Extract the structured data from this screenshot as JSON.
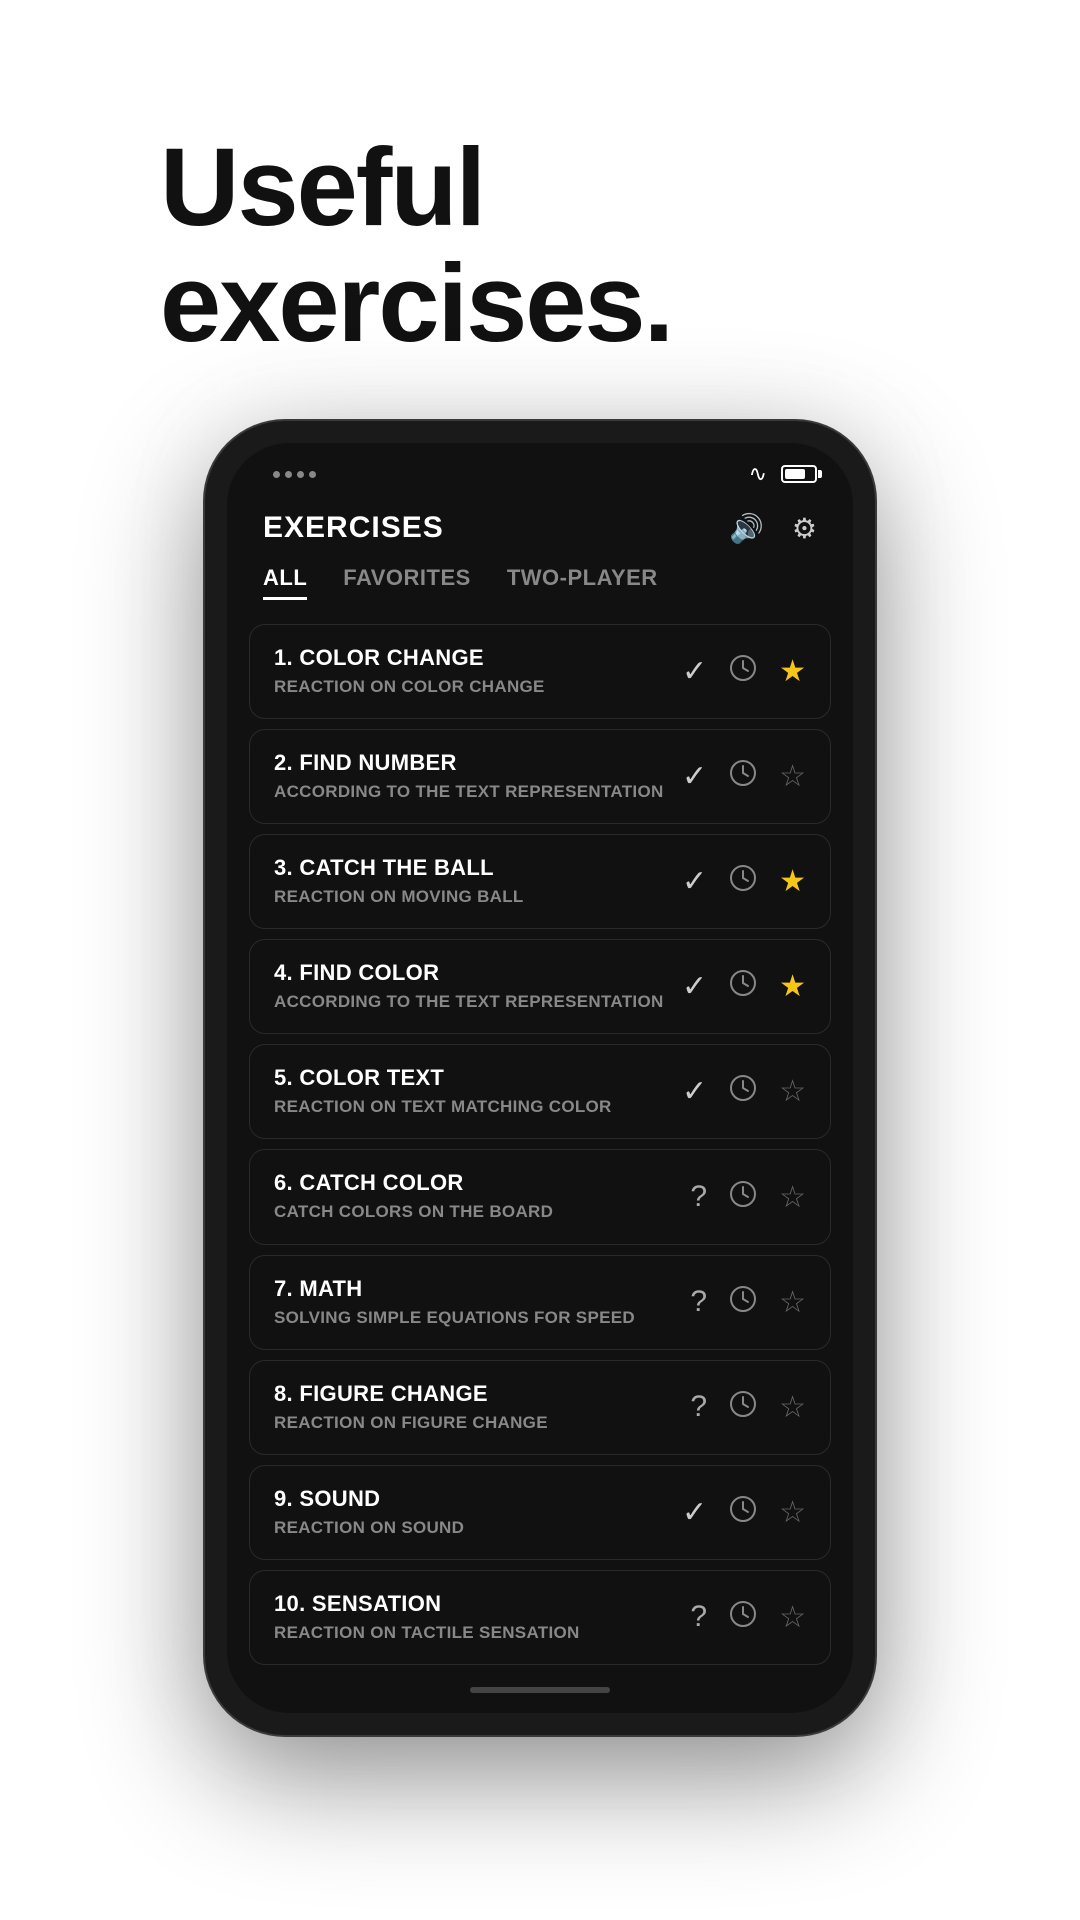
{
  "header": {
    "title_line1": "Useful",
    "title_line2": "exercises."
  },
  "app": {
    "screen_title": "EXERCISES",
    "tabs": [
      {
        "label": "ALL",
        "active": true
      },
      {
        "label": "FAVORITES",
        "active": false
      },
      {
        "label": "TWO-PLAYER",
        "active": false
      }
    ],
    "exercises": [
      {
        "number": "1.",
        "name": "COLOR CHANGE",
        "description": "REACTION ON COLOR CHANGE",
        "status": "check",
        "favorited": true
      },
      {
        "number": "2.",
        "name": "FIND NUMBER",
        "description": "ACCORDING TO THE TEXT REPRESENTATION",
        "status": "check",
        "favorited": false
      },
      {
        "number": "3.",
        "name": "CATCH THE BALL",
        "description": "REACTION ON MOVING BALL",
        "status": "check",
        "favorited": true
      },
      {
        "number": "4.",
        "name": "FIND COLOR",
        "description": "ACCORDING TO THE TEXT REPRESENTATION",
        "status": "check",
        "favorited": true
      },
      {
        "number": "5.",
        "name": "COLOR TEXT",
        "description": "REACTION ON TEXT MATCHING COLOR",
        "status": "check",
        "favorited": false
      },
      {
        "number": "6.",
        "name": "CATCH COLOR",
        "description": "CATCH COLORS ON THE BOARD",
        "status": "question",
        "favorited": false
      },
      {
        "number": "7.",
        "name": "MATH",
        "description": "SOLVING SIMPLE EQUATIONS FOR SPEED",
        "status": "question",
        "favorited": false
      },
      {
        "number": "8.",
        "name": "FIGURE CHANGE",
        "description": "REACTION ON FIGURE CHANGE",
        "status": "question",
        "favorited": false
      },
      {
        "number": "9.",
        "name": "SOUND",
        "description": "REACTION ON SOUND",
        "status": "check",
        "favorited": false
      },
      {
        "number": "10.",
        "name": "SENSATION",
        "description": "REACTION ON TACTILE SENSATION",
        "status": "question",
        "favorited": false
      }
    ]
  },
  "icons": {
    "sound": "🔔",
    "settings": "⚙",
    "wifi": "▾",
    "check": "✓",
    "question": "?",
    "clock": "🕐",
    "star_filled": "★",
    "star_empty": "☆"
  }
}
